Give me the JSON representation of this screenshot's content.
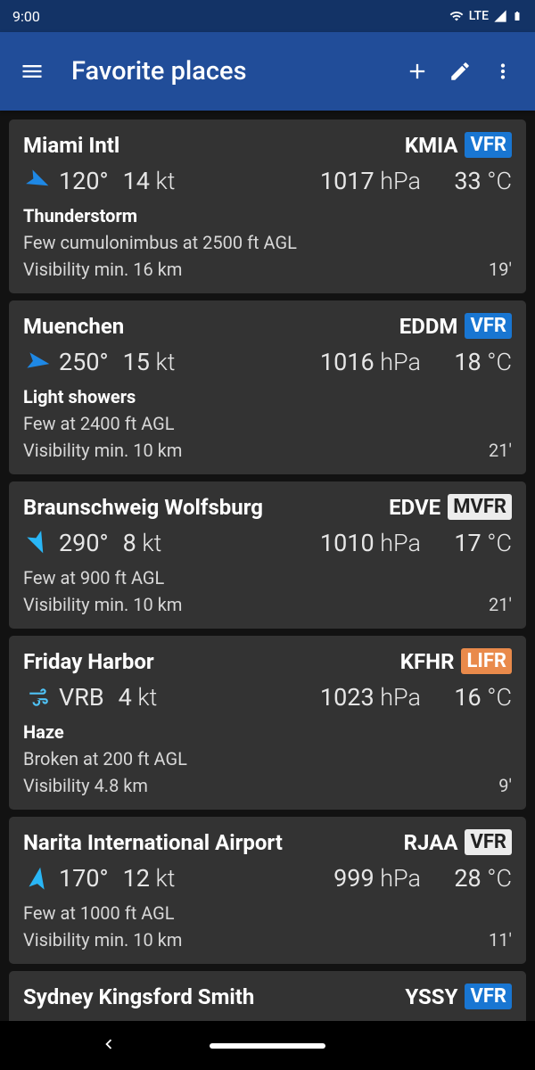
{
  "status": {
    "time": "9:00",
    "network": "LTE"
  },
  "header": {
    "title": "Favorite places"
  },
  "places": [
    {
      "name": "Miami Intl",
      "icao": "KMIA",
      "flight_rules": "VFR",
      "badge_style": "VFR-blue",
      "wind_icon": "arrow",
      "wind_rotation": 115,
      "wind_fill": "#1E88E5",
      "dir": "120°",
      "spd": "14",
      "spd_unit": "kt",
      "pres": "1017",
      "pres_unit": "hPa",
      "temp": "33",
      "temp_unit": "°C",
      "wx": "Thunderstorm",
      "clouds": "Few cumulonimbus at 2500 ft AGL",
      "vis": "Visibility min. 16 km",
      "age": "19'"
    },
    {
      "name": "Muenchen",
      "icao": "EDDM",
      "flight_rules": "VFR",
      "badge_style": "VFR-blue",
      "wind_icon": "arrow",
      "wind_rotation": 100,
      "wind_fill": "#1E88E5",
      "dir": "250°",
      "spd": "15",
      "spd_unit": "kt",
      "pres": "1016",
      "pres_unit": "hPa",
      "temp": "18",
      "temp_unit": "°C",
      "wx": "Light showers",
      "clouds": "Few at 2400 ft AGL",
      "vis": "Visibility min. 10 km",
      "age": "21'"
    },
    {
      "name": "Braunschweig Wolfsburg",
      "icao": "EDVE",
      "flight_rules": "MVFR",
      "badge_style": "MVFR",
      "wind_icon": "arrow",
      "wind_rotation": 155,
      "wind_fill": "#29B6F6",
      "dir": "290°",
      "spd": "8",
      "spd_unit": "kt",
      "pres": "1010",
      "pres_unit": "hPa",
      "temp": "17",
      "temp_unit": "°C",
      "wx": "",
      "clouds": "Few at 900 ft AGL",
      "vis": "Visibility min. 10 km",
      "age": "21'"
    },
    {
      "name": "Friday Harbor",
      "icao": "KFHR",
      "flight_rules": "LIFR",
      "badge_style": "LIFR",
      "wind_icon": "wind-lines",
      "wind_rotation": 0,
      "wind_fill": "#4FC3F7",
      "dir": "VRB",
      "spd": "4",
      "spd_unit": "kt",
      "pres": "1023",
      "pres_unit": "hPa",
      "temp": "16",
      "temp_unit": "°C",
      "wx": "Haze",
      "clouds": "Broken at 200 ft AGL",
      "vis": "Visibility 4.8 km",
      "age": "9'"
    },
    {
      "name": "Narita International Airport",
      "icao": "RJAA",
      "flight_rules": "VFR",
      "badge_style": "VFR-white",
      "wind_icon": "arrow",
      "wind_rotation": 10,
      "wind_fill": "#29B6F6",
      "dir": "170°",
      "spd": "12",
      "spd_unit": "kt",
      "pres": "999",
      "pres_unit": "hPa",
      "temp": "28",
      "temp_unit": "°C",
      "wx": "",
      "clouds": "Few at 1000 ft AGL",
      "vis": "Visibility min. 10 km",
      "age": "11'"
    },
    {
      "name": "Sydney Kingsford Smith",
      "icao": "YSSY",
      "flight_rules": "VFR",
      "badge_style": "VFR-blue",
      "wind_icon": "arrow",
      "wind_rotation": 0,
      "wind_fill": "#1E88E5",
      "dir": "",
      "spd": "",
      "spd_unit": "",
      "pres": "",
      "pres_unit": "",
      "temp": "",
      "temp_unit": "",
      "wx": "",
      "clouds": "",
      "vis": "",
      "age": ""
    }
  ]
}
